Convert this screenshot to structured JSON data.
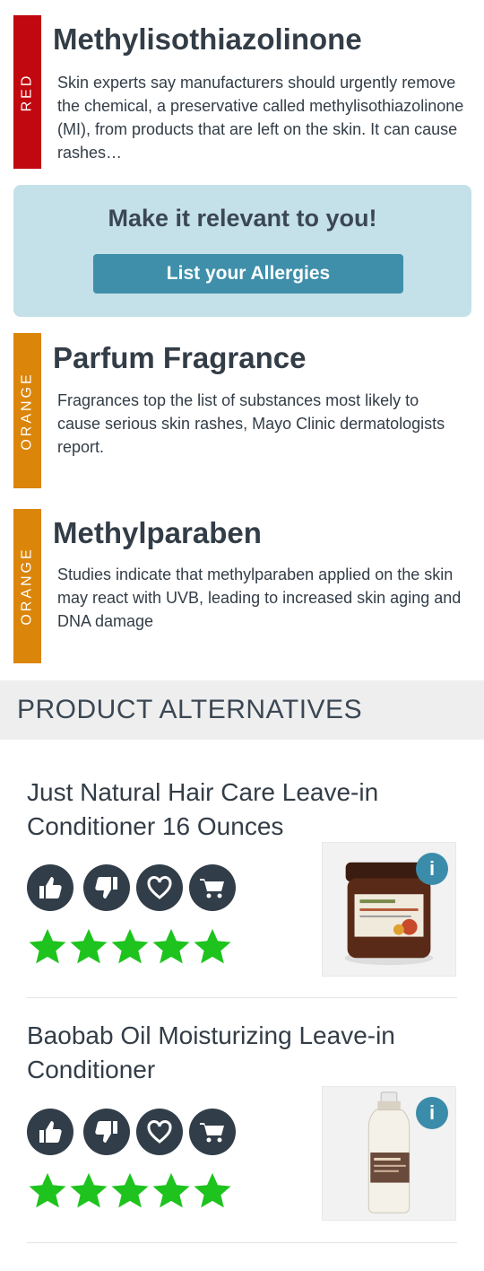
{
  "ingredients": [
    {
      "risk": "RED",
      "risk_color": "#c1070f",
      "name": "Methylisothiazolinone",
      "description": "Skin experts say manufacturers should urgently remove the chemical, a preservative called methylisothiazolinone (MI), from products that are left on the skin. It can cause rashes…"
    },
    {
      "risk": "ORANGE",
      "risk_color": "#db850b",
      "name": "Parfum Fragrance",
      "description": "Fragrances top the list of substances most likely to cause serious skin rashes, Mayo Clinic dermatologists report."
    },
    {
      "risk": "ORANGE",
      "risk_color": "#db850b",
      "name": "Methylparaben",
      "description": "Studies indicate that methylparaben applied on the skin may react with UVB, leading to increased skin aging and DNA damage"
    }
  ],
  "cta": {
    "title": "Make it relevant to you!",
    "button_label": "List your Allergies"
  },
  "alternatives": {
    "header": "PRODUCT ALTERNATIVES",
    "products": [
      {
        "name": "Just Natural Hair Care Leave-in Conditioner 16 Ounces",
        "rating": 5,
        "info_label": "i",
        "actions": [
          "thumbs-up-icon",
          "thumbs-down-icon",
          "heart-icon",
          "cart-icon"
        ]
      },
      {
        "name": "Baobab Oil Moisturizing Leave-in Conditioner",
        "rating": 5,
        "info_label": "i",
        "actions": [
          "thumbs-up-icon",
          "thumbs-down-icon",
          "heart-icon",
          "cart-icon"
        ]
      }
    ]
  },
  "colors": {
    "text": "#333d47",
    "cta_bg": "#c4e1e9",
    "cta_button": "#3f8faa",
    "icon_circle": "#313d48",
    "star": "#1ec31e",
    "info": "#3b8caa"
  }
}
